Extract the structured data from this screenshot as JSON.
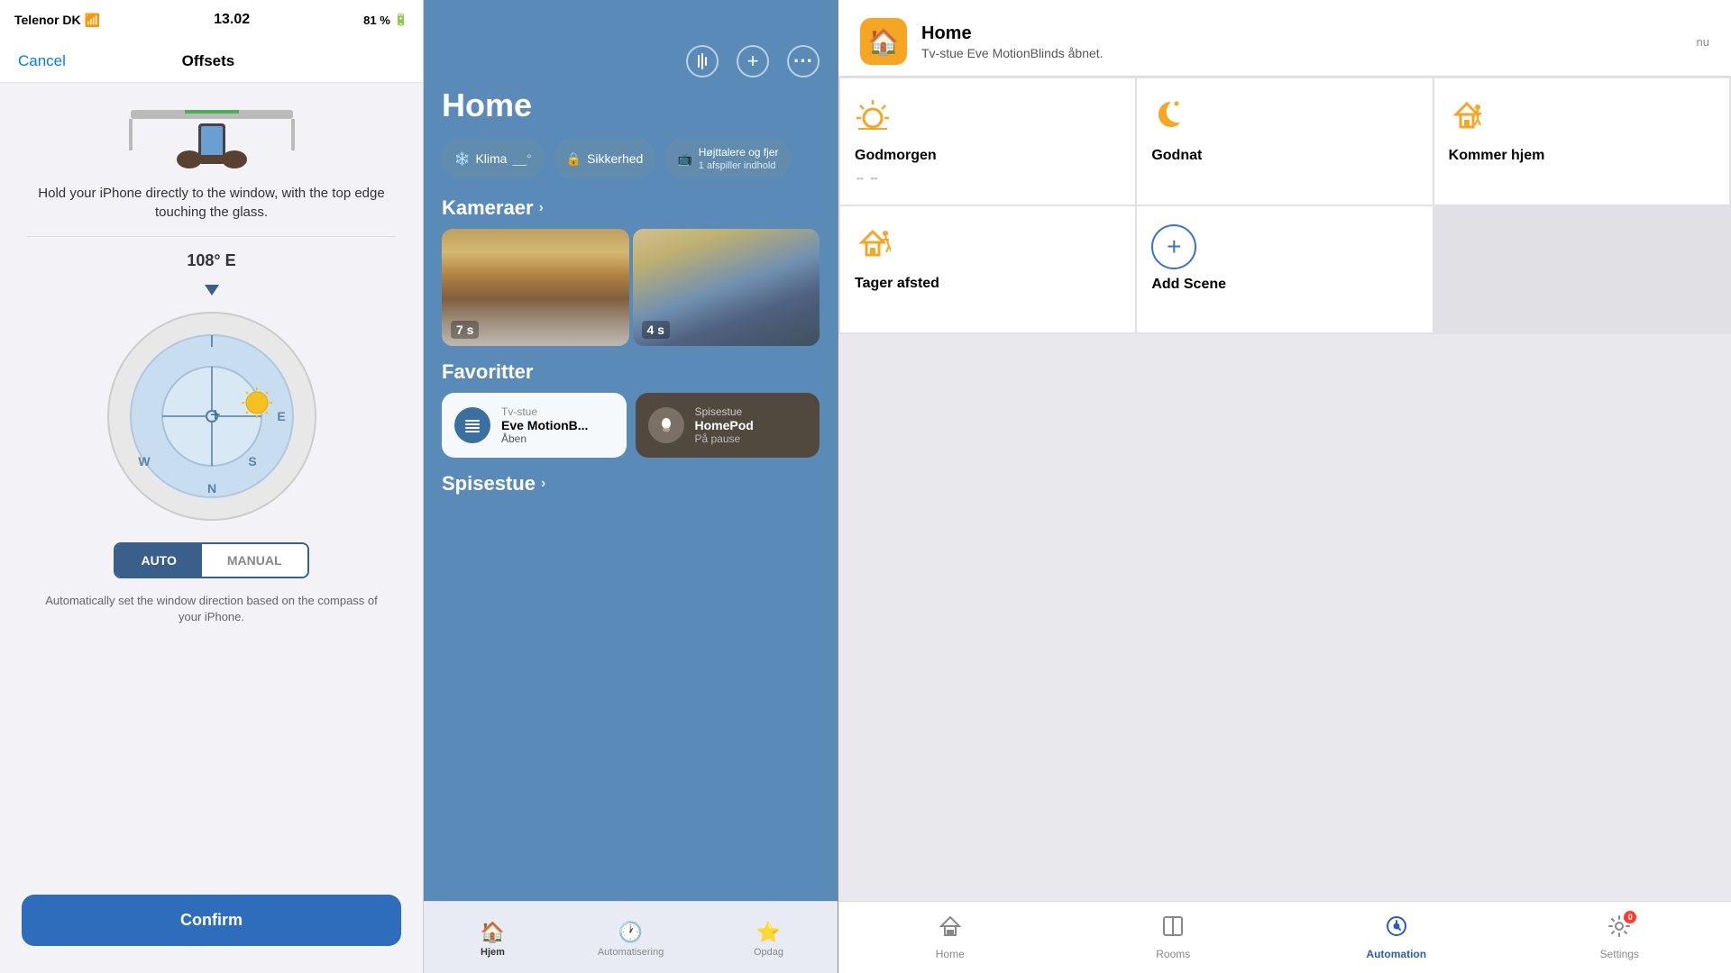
{
  "panel1": {
    "status_bar": {
      "carrier": "Telenor DK",
      "time": "13.02",
      "battery": "81 %"
    },
    "nav": {
      "cancel_label": "Cancel",
      "title": "Offsets"
    },
    "instruction": "Hold your iPhone directly to the window, with the top edge touching the glass.",
    "compass": {
      "degree_label": "108° E",
      "directions": [
        "E",
        "S",
        "N",
        "W"
      ]
    },
    "mode_buttons": {
      "auto_label": "AUTO",
      "manual_label": "MANUAL"
    },
    "auto_description": "Automatically set the window direction based on the compass of your iPhone.",
    "confirm_label": "Confirm"
  },
  "panel2": {
    "title": "Home",
    "categories": [
      {
        "label": "Klima",
        "sub": "__°"
      },
      {
        "label": "Sikkerhed"
      },
      {
        "label": "Højttalere og fjer",
        "sub": "1 afspiller indhold"
      }
    ],
    "cameras_section": "Kameraer",
    "cameras": [
      {
        "timer": "7 s"
      },
      {
        "timer": "4 s"
      }
    ],
    "favoritter_section": "Favoritter",
    "favorites": [
      {
        "room": "Tv-stue",
        "name": "Eve MotionB...",
        "status": "Åben",
        "dark": false
      },
      {
        "room": "Spisestue",
        "name": "HomePod",
        "status": "På pause",
        "dark": true
      }
    ],
    "spisestue_section": "Spisestue",
    "bottom_nav": [
      {
        "label": "Hjem",
        "active": true
      },
      {
        "label": "Automatisering",
        "active": false
      },
      {
        "label": "Opdag",
        "active": false
      }
    ]
  },
  "panel3": {
    "top_bar": {
      "home_name": "Home",
      "subtitle": "Tv-stue Eve MotionBlinds åbnet.",
      "timestamp": "nu"
    },
    "scenes": [
      {
        "name": "Godmorgen",
        "subtitle": "⇔ ⇔",
        "icon": "sunrise"
      },
      {
        "name": "Godnat",
        "subtitle": "",
        "icon": "moon"
      },
      {
        "name": "Kommer hjem",
        "subtitle": "",
        "icon": "house_person"
      },
      {
        "name": "Tager afsted",
        "subtitle": "",
        "icon": "house_leave"
      },
      {
        "name": "Add Scene",
        "subtitle": "",
        "icon": "plus"
      }
    ],
    "bottom_nav": [
      {
        "label": "Home",
        "active": false
      },
      {
        "label": "Rooms",
        "active": false
      },
      {
        "label": "Automation",
        "active": true
      },
      {
        "label": "Settings",
        "active": false,
        "badge": "0"
      }
    ]
  }
}
